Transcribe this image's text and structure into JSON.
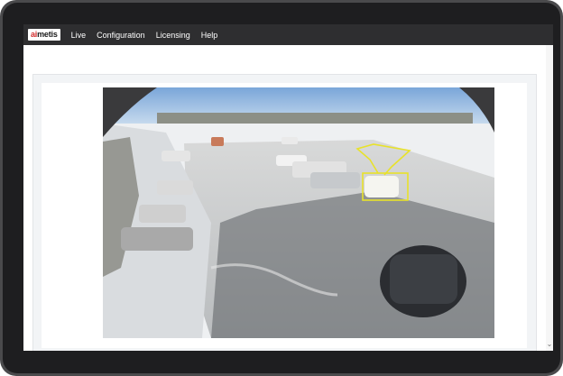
{
  "app": {
    "logo_prefix": "ai",
    "logo_suffix": "metis"
  },
  "nav": {
    "items": [
      {
        "label": "Live"
      },
      {
        "label": "Configuration"
      },
      {
        "label": "Licensing"
      },
      {
        "label": "Help"
      }
    ]
  },
  "video": {
    "description": "",
    "detection_color": "#e8e22b"
  },
  "icons": {
    "scroll_down": "chevron-down-icon"
  }
}
